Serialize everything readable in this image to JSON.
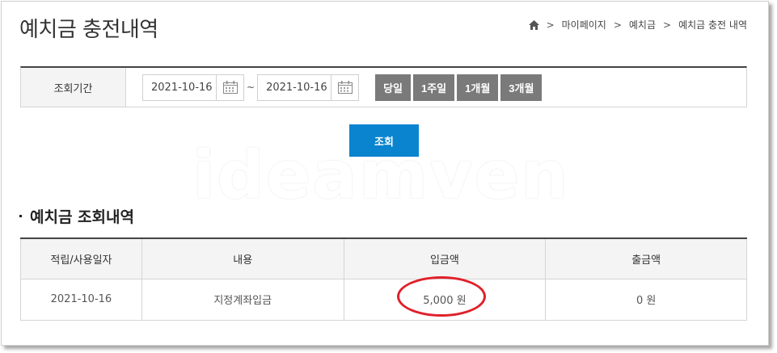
{
  "header": {
    "title": "예치금 충전내역",
    "breadcrumb": [
      {
        "label": "마이페이지"
      },
      {
        "label": "예치금"
      },
      {
        "label": "예치금 충전 내역"
      }
    ]
  },
  "filter": {
    "label": "조회기간",
    "start_date": "2021-10-16",
    "end_date": "2021-10-16",
    "separator": "~",
    "period_buttons": [
      "당일",
      "1주일",
      "1개월",
      "3개월"
    ],
    "search_label": "조회"
  },
  "watermark": "ideamven",
  "section": {
    "title": "예치금 조회내역"
  },
  "table": {
    "columns": [
      "적립/사용일자",
      "내용",
      "입금액",
      "출금액"
    ],
    "rows": [
      {
        "date": "2021-10-16",
        "content": "지정계좌입금",
        "deposit": "5,000 원",
        "withdrawal": "0 원"
      }
    ]
  },
  "colors": {
    "search_button": "#0a84cf",
    "period_button": "#7a7a7a",
    "highlight": "#e0202a"
  }
}
